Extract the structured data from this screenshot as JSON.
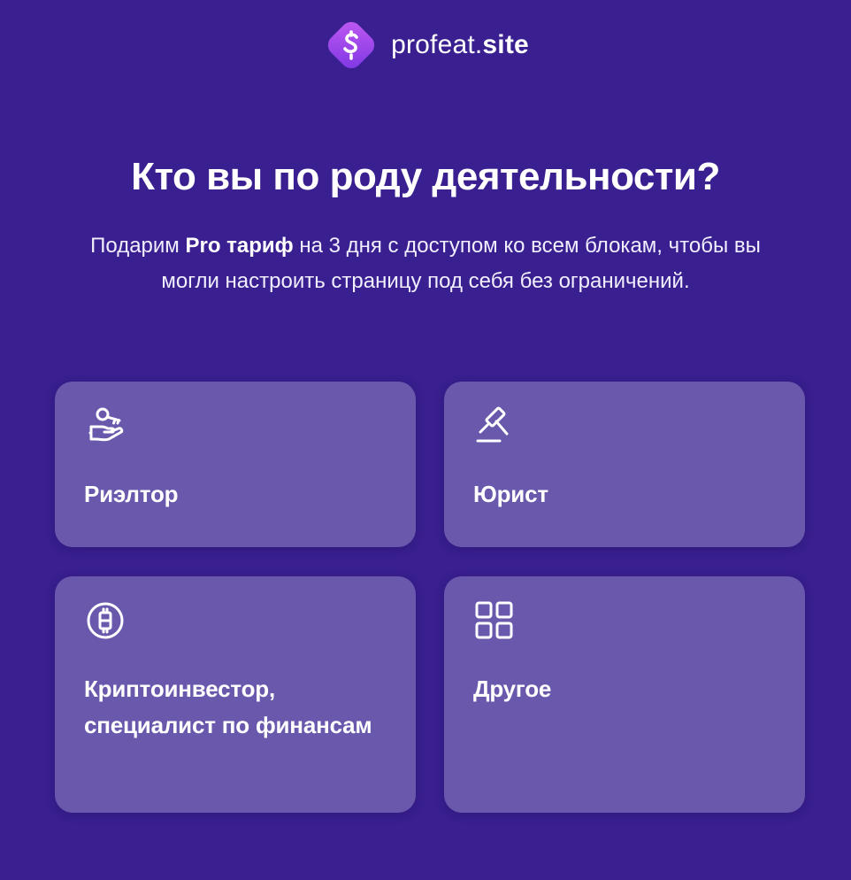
{
  "brand": {
    "name_light": "profeat.",
    "name_bold": "site",
    "logo_icon": "s-logo-icon",
    "accent_gradient": [
      "#b44ef0",
      "#7c3ae6"
    ]
  },
  "heading": {
    "title": "Кто вы по роду деятельности?",
    "subtitle_pre": "Подарим ",
    "subtitle_bold": "Pro тариф",
    "subtitle_post": " на 3 дня с доступом ко всем блокам, чтобы вы могли настроить страницу под себя без ограничений."
  },
  "options": [
    {
      "label": "Риэлтор",
      "icon": "hand-key-icon"
    },
    {
      "label": "Юрист",
      "icon": "gavel-icon"
    },
    {
      "label": "Криптоинвестор, специалист по финансам",
      "icon": "crypto-coin-icon"
    },
    {
      "label": "Другое",
      "icon": "grid-icon"
    }
  ],
  "colors": {
    "background": "#391f8f",
    "card": "#6a58ad",
    "text": "#ffffff"
  }
}
